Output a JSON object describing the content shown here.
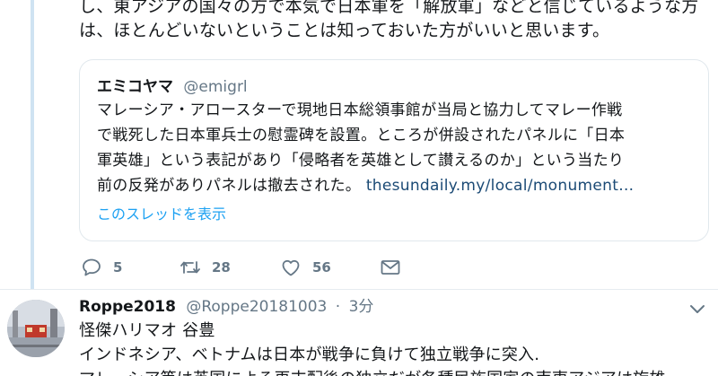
{
  "tweet": {
    "text_line1": "し、東アジアの国々の方で本気で日本軍を「解放軍」などと信じているような方",
    "text_line2": "は、ほとんどいないということは知っておいた方がいいと思います。"
  },
  "quote": {
    "name": "エミコヤマ",
    "handle": "@emigrl",
    "lines": [
      "マレーシア・アロースターで現地日本総領事館が当局と協力してマレー作戦",
      "で戦死した日本軍兵士の慰霊碑を設置。ところが併設されたパネルに「日本",
      "軍英雄」という表記があり「侵略者を英雄として讃えるのか」という当たり",
      "前の反発がありパネルは撤去された。"
    ],
    "link": "thesundaily.my/local/monument…",
    "show_thread": "このスレッドを表示"
  },
  "actions": {
    "reply_count": "5",
    "retweet_count": "28",
    "like_count": "56",
    "reply_icon": "reply-icon",
    "retweet_icon": "retweet-icon",
    "like_icon": "heart-icon",
    "message_icon": "envelope-icon"
  },
  "reply": {
    "name": "Roppe2018",
    "handle": "@Roppe20181003",
    "separator": "·",
    "time": "3分",
    "lines": [
      "怪傑ハリマオ 谷豊",
      "インドネシア、ベトナムは日本が戦争に負けて独立戦争に突入.",
      "マレーシア等は英国による再支配後の独立だが各種民族国家の南東アジアは旋雄"
    ]
  },
  "colors": {
    "text": "#14171a",
    "secondary": "#657786",
    "accent": "#1da1f2",
    "thread_line": "#cfe3f2",
    "border": "#e1e8ed"
  }
}
